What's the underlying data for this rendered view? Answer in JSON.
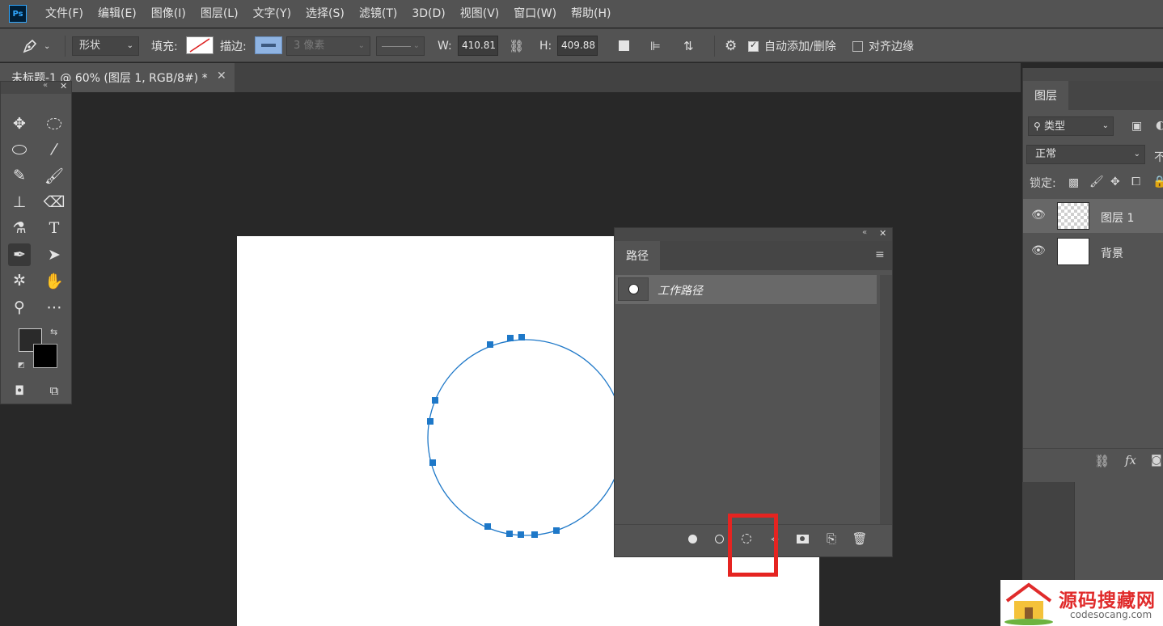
{
  "app": {
    "logo": "Ps"
  },
  "menu": [
    "文件(F)",
    "编辑(E)",
    "图像(I)",
    "图层(L)",
    "文字(Y)",
    "选择(S)",
    "滤镜(T)",
    "3D(D)",
    "视图(V)",
    "窗口(W)",
    "帮助(H)"
  ],
  "options": {
    "tool_icon": "pen-icon",
    "mode": "形状",
    "fill_label": "填充:",
    "stroke_label": "描边:",
    "stroke_width": "3 像素",
    "w_label": "W:",
    "w_value": "410.81",
    "h_label": "H:",
    "h_value": "409.88",
    "auto_add_delete": "自动添加/删除",
    "auto_add_delete_checked": true,
    "align_edges": "对齐边缘",
    "align_edges_checked": false
  },
  "document": {
    "tab_title": "未标题-1 @ 60% (图层 1, RGB/8#) *"
  },
  "colors": {
    "foreground": "#2a2a2a",
    "background": "#000000",
    "path": "#1e78c8",
    "anchor": "#1e78c8",
    "highlight": "#e52421"
  },
  "paths_panel": {
    "tab": "路径",
    "items": [
      {
        "name": "工作路径"
      }
    ],
    "buttons": [
      "fill-path-icon",
      "stroke-path-icon",
      "load-selection-icon",
      "make-work-path-icon",
      "add-mask-icon",
      "new-path-icon",
      "trash-icon"
    ]
  },
  "layers_panel": {
    "tab": "图层",
    "filter_kind": "类型",
    "blend_mode": "正常",
    "opacity_label": "不",
    "lock_label": "锁定:",
    "layers": [
      {
        "name": "图层 1",
        "selected": true
      },
      {
        "name": "背景",
        "selected": false
      }
    ]
  },
  "watermark": {
    "title": "源码搜藏网",
    "url": "codesocang.com"
  }
}
